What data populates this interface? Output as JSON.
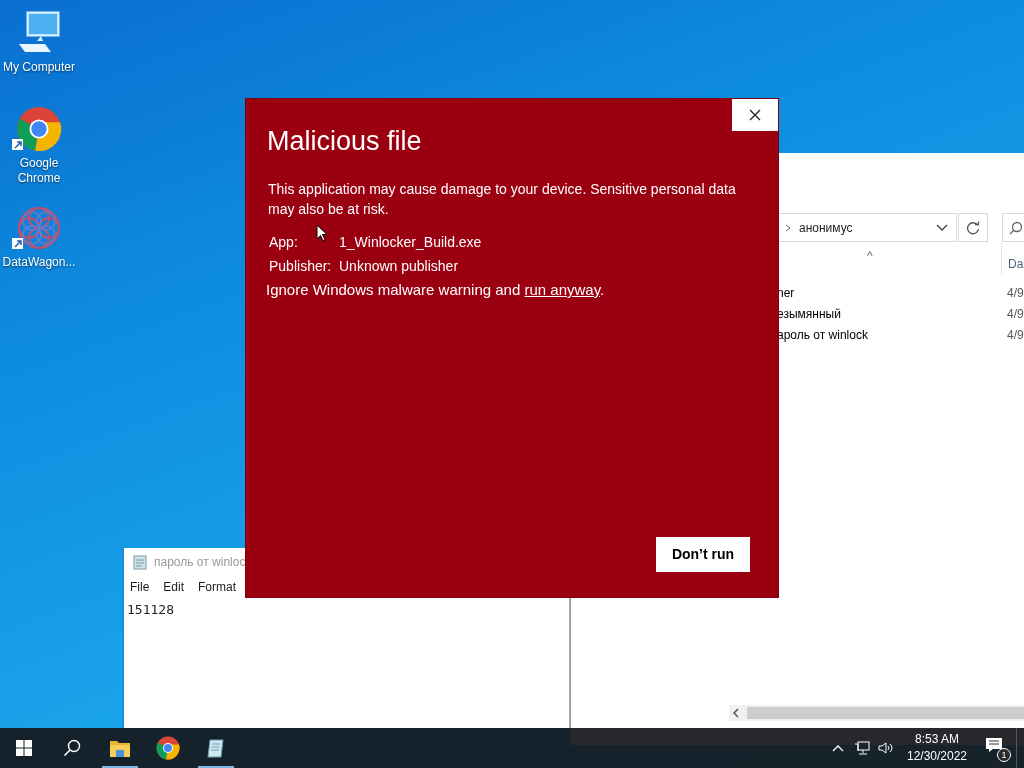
{
  "desktop_icons": [
    {
      "kind": "computer",
      "label": "My Computer"
    },
    {
      "kind": "chrome",
      "label": "Google Chrome"
    },
    {
      "kind": "app",
      "label": "DataWagon..."
    }
  ],
  "explorer": {
    "breadcrumb": "анонимус",
    "sort_caret": "^",
    "column_header": "Da",
    "files": [
      {
        "name": "ner",
        "date": "4/9"
      },
      {
        "name": "езымянный",
        "date": "4/9"
      },
      {
        "name": "ароль от winlock",
        "date": "4/9"
      }
    ]
  },
  "notepad": {
    "title": "пароль от winloc",
    "menu": [
      "File",
      "Edit",
      "Format"
    ],
    "content": "151128"
  },
  "dialog": {
    "title": "Malicious file",
    "message": "This application may cause damage to your device. Sensitive personal data may also be at risk.",
    "app_label": "App:",
    "app_value": "1_Winlocker_Build.exe",
    "publisher_label": "Publisher:",
    "publisher_value": "Unknown publisher",
    "warning_text": "Ignore Windows malware warning and",
    "warning_link": "run anyway",
    "warning_end": ".",
    "button": "Don’t run"
  },
  "taskbar": {
    "apps": [
      {
        "kind": "explorer",
        "running": true
      },
      {
        "kind": "chrome",
        "running": false
      },
      {
        "kind": "notepad",
        "running": true
      }
    ],
    "time": "8:53 AM",
    "date": "12/30/2022",
    "notification_count": "1"
  }
}
